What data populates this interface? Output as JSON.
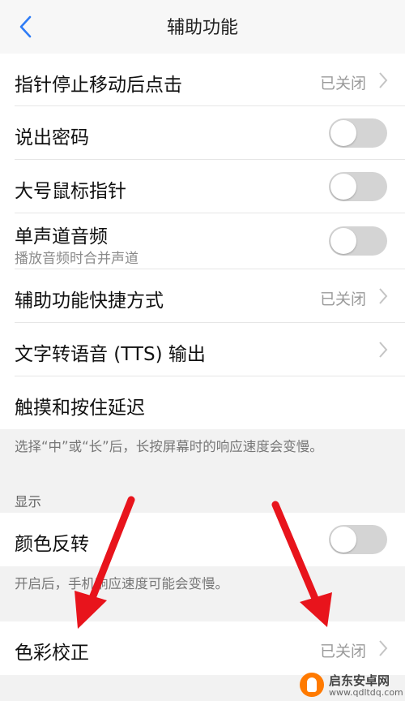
{
  "header": {
    "title": "辅助功能",
    "back_icon": "chevron-left-icon"
  },
  "rows": [
    {
      "label": "指针停止移动后点击",
      "value": "已关闭"
    },
    {
      "label": "说出密码",
      "toggle": false
    },
    {
      "label": "大号鼠标指针",
      "toggle": false
    },
    {
      "label": "单声道音频",
      "sub": "播放音频时合并声道",
      "toggle": false
    },
    {
      "label": "辅助功能快捷方式",
      "value": "已关闭"
    },
    {
      "label": "文字转语音 (TTS) 输出"
    },
    {
      "label": "触摸和按住延迟"
    }
  ],
  "notes": {
    "touch_delay": "选择“中”或“长”后，长按屏幕时的响应速度会变慢。",
    "color_inversion": "开启后，手机响应速度可能会变慢。"
  },
  "display_section": {
    "title": "显示",
    "color_inversion": {
      "label": "颜色反转",
      "toggle": false
    },
    "color_correction": {
      "label": "色彩校正",
      "value": "已关闭"
    }
  },
  "watermark": {
    "name": "启东安卓网",
    "url": "www.qdltdq.com"
  },
  "colors": {
    "accent": "#2e7cf6",
    "toggle_off": "#d4d4d4",
    "annotation_arrow": "#e8141c",
    "background": "#f2f2f2"
  }
}
